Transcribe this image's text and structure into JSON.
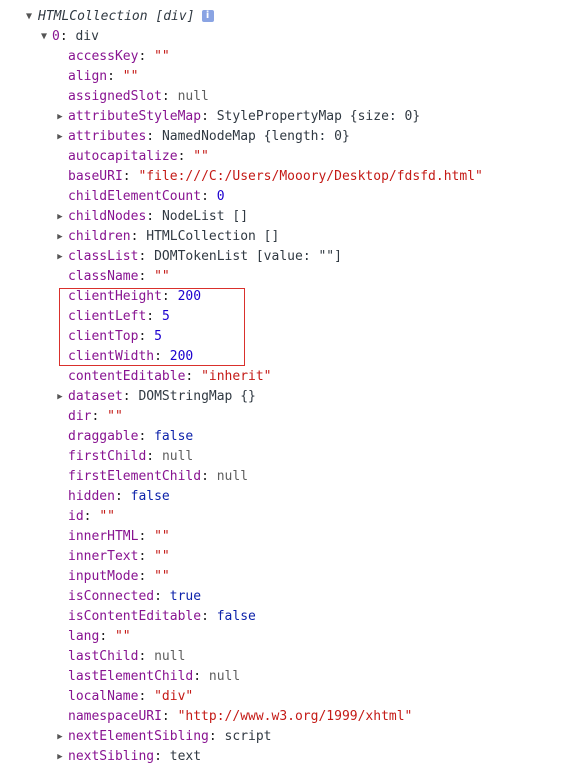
{
  "header": {
    "label": "HTMLCollection [div]",
    "info_icon": "info-icon",
    "info_glyph": "i"
  },
  "node": {
    "index": "0",
    "type": "div"
  },
  "properties": [
    {
      "name": "accessKey",
      "value": "\"\"",
      "kind": "string",
      "expandable": false
    },
    {
      "name": "align",
      "value": "\"\"",
      "kind": "string",
      "expandable": false
    },
    {
      "name": "assignedSlot",
      "value": "null",
      "kind": "null",
      "expandable": false
    },
    {
      "name": "attributeStyleMap",
      "value": "StylePropertyMap {size: 0}",
      "kind": "object",
      "expandable": true
    },
    {
      "name": "attributes",
      "value": "NamedNodeMap {length: 0}",
      "kind": "object",
      "expandable": true
    },
    {
      "name": "autocapitalize",
      "value": "\"\"",
      "kind": "string",
      "expandable": false
    },
    {
      "name": "baseURI",
      "value": "\"file:///C:/Users/Mooory/Desktop/fdsfd.html\"",
      "kind": "string",
      "expandable": false
    },
    {
      "name": "childElementCount",
      "value": "0",
      "kind": "number",
      "expandable": false
    },
    {
      "name": "childNodes",
      "value": "NodeList []",
      "kind": "object",
      "expandable": true
    },
    {
      "name": "children",
      "value": "HTMLCollection []",
      "kind": "object",
      "expandable": true
    },
    {
      "name": "classList",
      "value": "DOMTokenList [value: \"\"]",
      "kind": "object",
      "expandable": true
    },
    {
      "name": "className",
      "value": "\"\"",
      "kind": "string",
      "expandable": false
    },
    {
      "name": "clientHeight",
      "value": "200",
      "kind": "number",
      "expandable": false
    },
    {
      "name": "clientLeft",
      "value": "5",
      "kind": "number",
      "expandable": false
    },
    {
      "name": "clientTop",
      "value": "5",
      "kind": "number",
      "expandable": false
    },
    {
      "name": "clientWidth",
      "value": "200",
      "kind": "number",
      "expandable": false
    },
    {
      "name": "contentEditable",
      "value": "\"inherit\"",
      "kind": "string",
      "expandable": false
    },
    {
      "name": "dataset",
      "value": "DOMStringMap {}",
      "kind": "object",
      "expandable": true
    },
    {
      "name": "dir",
      "value": "\"\"",
      "kind": "string",
      "expandable": false
    },
    {
      "name": "draggable",
      "value": "false",
      "kind": "bool",
      "expandable": false
    },
    {
      "name": "firstChild",
      "value": "null",
      "kind": "null",
      "expandable": false
    },
    {
      "name": "firstElementChild",
      "value": "null",
      "kind": "null",
      "expandable": false
    },
    {
      "name": "hidden",
      "value": "false",
      "kind": "bool",
      "expandable": false
    },
    {
      "name": "id",
      "value": "\"\"",
      "kind": "string",
      "expandable": false
    },
    {
      "name": "innerHTML",
      "value": "\"\"",
      "kind": "string",
      "expandable": false
    },
    {
      "name": "innerText",
      "value": "\"\"",
      "kind": "string",
      "expandable": false
    },
    {
      "name": "inputMode",
      "value": "\"\"",
      "kind": "string",
      "expandable": false
    },
    {
      "name": "isConnected",
      "value": "true",
      "kind": "bool",
      "expandable": false
    },
    {
      "name": "isContentEditable",
      "value": "false",
      "kind": "bool",
      "expandable": false
    },
    {
      "name": "lang",
      "value": "\"\"",
      "kind": "string",
      "expandable": false
    },
    {
      "name": "lastChild",
      "value": "null",
      "kind": "null",
      "expandable": false
    },
    {
      "name": "lastElementChild",
      "value": "null",
      "kind": "null",
      "expandable": false
    },
    {
      "name": "localName",
      "value": "\"div\"",
      "kind": "string",
      "expandable": false
    },
    {
      "name": "namespaceURI",
      "value": "\"http://www.w3.org/1999/xhtml\"",
      "kind": "string",
      "expandable": false
    },
    {
      "name": "nextElementSibling",
      "value": "script",
      "kind": "object",
      "expandable": true
    },
    {
      "name": "nextSibling",
      "value": "text",
      "kind": "object",
      "expandable": true
    }
  ],
  "highlight": {
    "from_property": "clientHeight",
    "to_property": "clientWidth",
    "color": "#d9302c"
  },
  "colors": {
    "property_name": "#881391",
    "string_value": "#c41a16",
    "number_value": "#1c00cf",
    "boolean_value": "#0d22aa",
    "null_value": "#5e5e5e",
    "object_value": "#303942",
    "info_icon_bg": "#8aa4e3"
  }
}
